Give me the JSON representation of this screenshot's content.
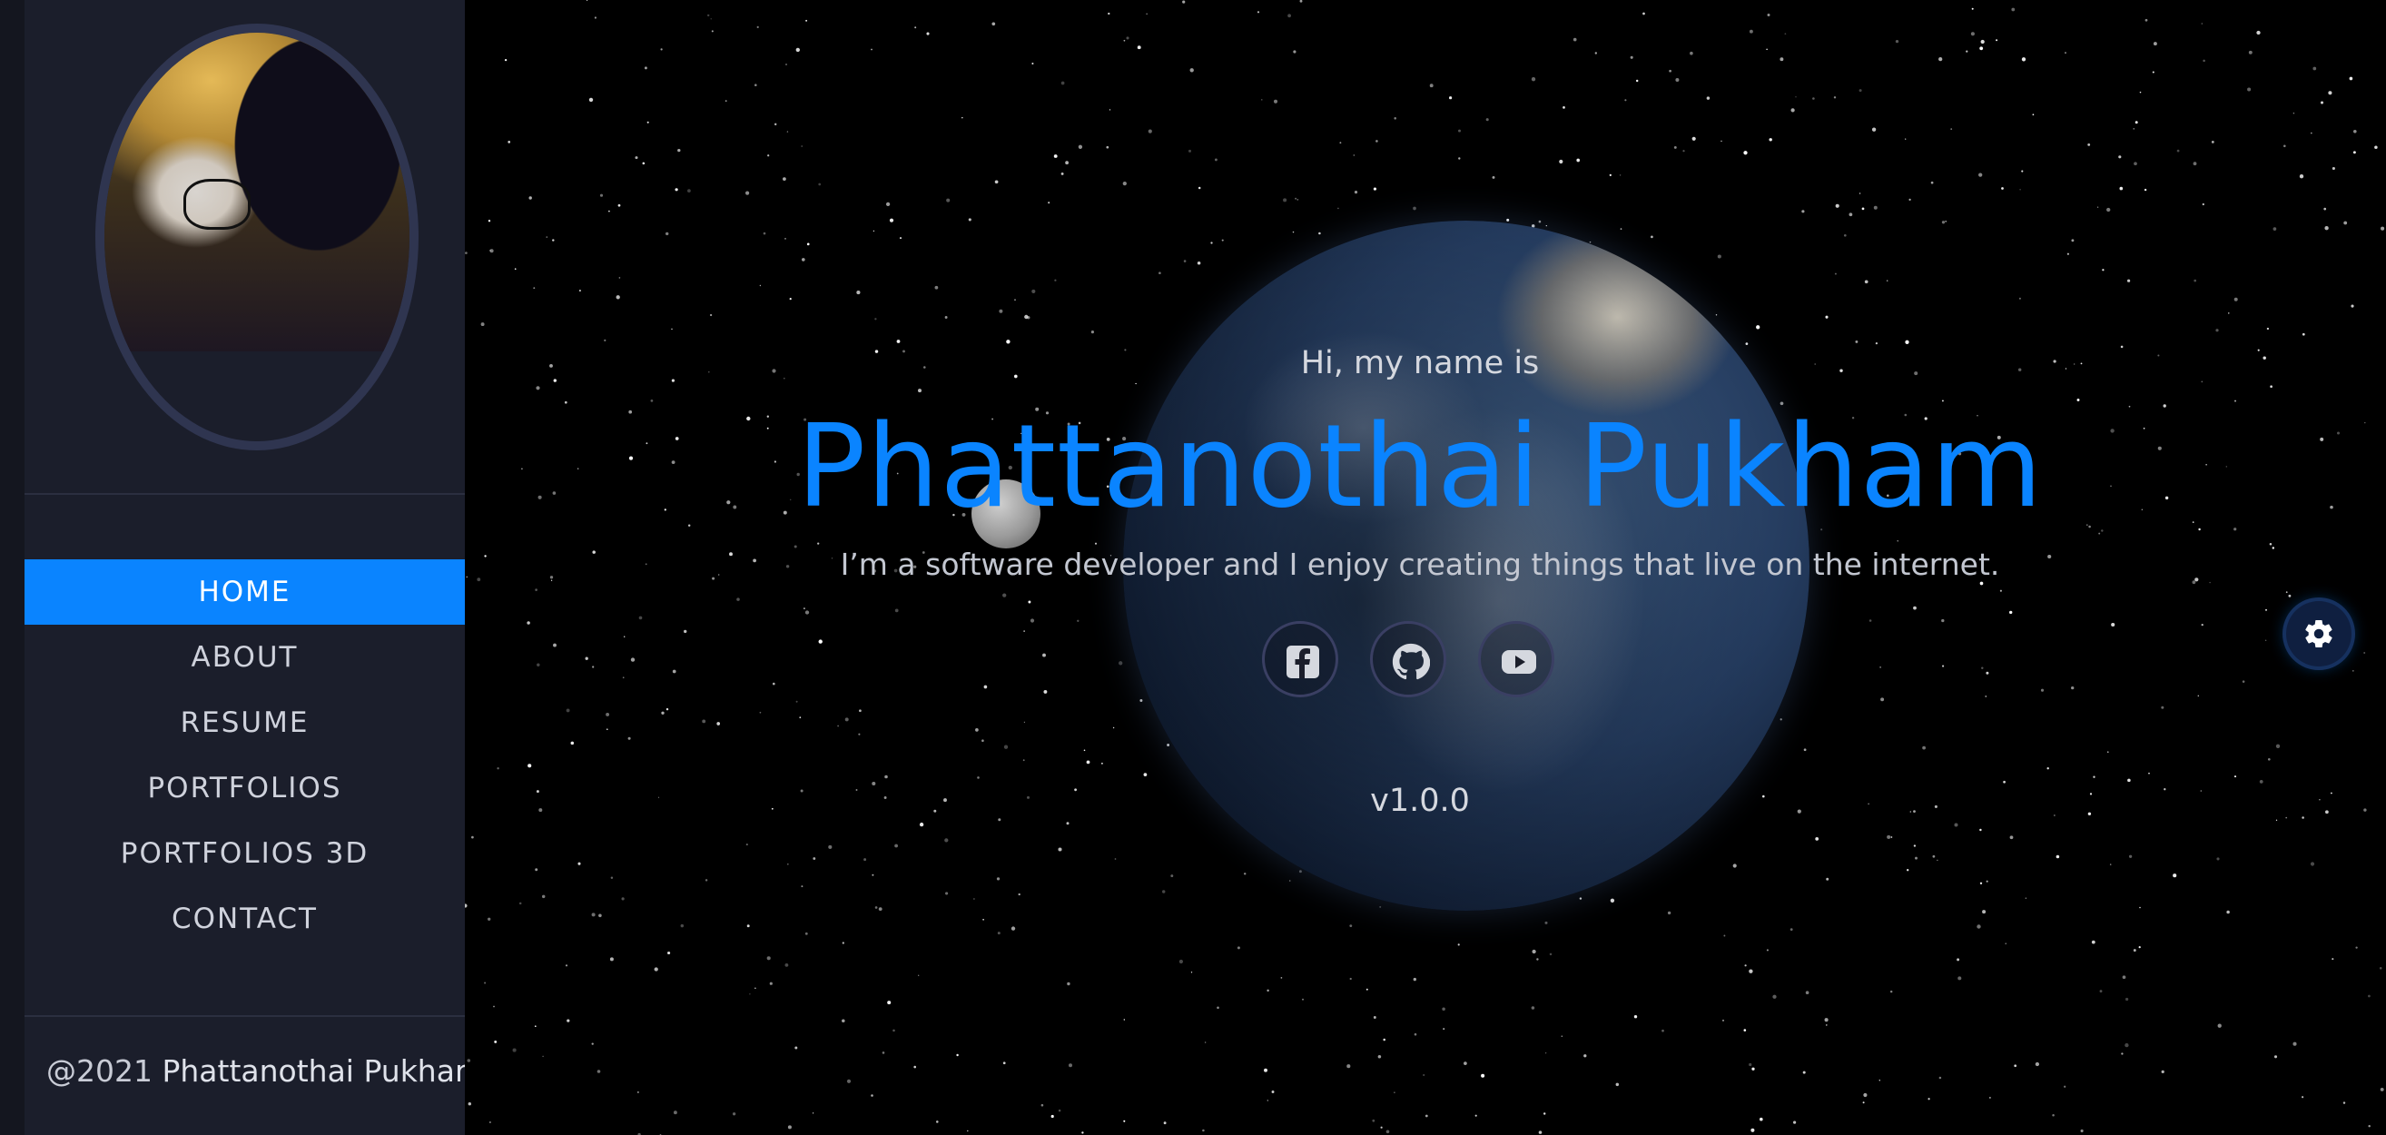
{
  "sidebar": {
    "profile_image_alt": "profile photo",
    "nav": [
      {
        "label": "HOME",
        "active": true
      },
      {
        "label": "ABOUT",
        "active": false
      },
      {
        "label": "RESUME",
        "active": false
      },
      {
        "label": "PORTFOLIOS",
        "active": false
      },
      {
        "label": "PORTFOLIOS 3D",
        "active": false
      },
      {
        "label": "CONTACT",
        "active": false
      }
    ],
    "footer_prefix": "@2021",
    "footer_name": "Phattanothai Pukham"
  },
  "hero": {
    "greeting": "Hi, my name is",
    "name": "Phattanothai Pukham",
    "tagline": "I’m a software developer and I enjoy creating things that live on the internet.",
    "socials": [
      {
        "icon": "facebook-icon"
      },
      {
        "icon": "github-icon"
      },
      {
        "icon": "youtube-icon"
      }
    ],
    "version": "v1.0.0"
  },
  "settings": {
    "icon": "gear-icon"
  },
  "colors": {
    "accent": "#0a84ff",
    "sidebar_bg": "#1b1e2b",
    "space_bg": "#000000",
    "text_light": "#d5d8df"
  }
}
